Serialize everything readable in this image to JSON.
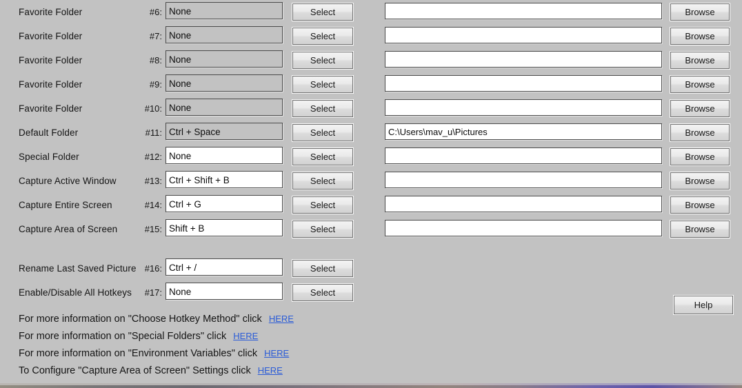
{
  "window": {
    "background_color": "#c2c2c2",
    "link_color": "#2a5bd7"
  },
  "buttons": {
    "select_label": "Select",
    "browse_label": "Browse",
    "help_label": "Help"
  },
  "rows": [
    {
      "label": "Favorite Folder",
      "number": "#6:",
      "hotkey": "None",
      "hotkey_disabled": true,
      "path": "",
      "has_path": true
    },
    {
      "label": "Favorite Folder",
      "number": "#7:",
      "hotkey": "None",
      "hotkey_disabled": true,
      "path": "",
      "has_path": true
    },
    {
      "label": "Favorite Folder",
      "number": "#8:",
      "hotkey": "None",
      "hotkey_disabled": true,
      "path": "",
      "has_path": true
    },
    {
      "label": "Favorite Folder",
      "number": "#9:",
      "hotkey": "None",
      "hotkey_disabled": true,
      "path": "",
      "has_path": true
    },
    {
      "label": "Favorite Folder",
      "number": "#10:",
      "hotkey": "None",
      "hotkey_disabled": true,
      "path": "",
      "has_path": true
    },
    {
      "label": "Default Folder",
      "number": "#11:",
      "hotkey": "Ctrl + Space",
      "hotkey_disabled": true,
      "path": "C:\\Users\\mav_u\\Pictures",
      "has_path": true
    },
    {
      "label": "Special Folder",
      "number": "#12:",
      "hotkey": "None",
      "hotkey_disabled": false,
      "path": "",
      "has_path": true
    },
    {
      "label": "Capture Active Window",
      "number": "#13:",
      "hotkey": "Ctrl + Shift + B",
      "hotkey_disabled": false,
      "path": "",
      "has_path": true
    },
    {
      "label": "Capture Entire Screen",
      "number": "#14:",
      "hotkey": "Ctrl + G",
      "hotkey_disabled": false,
      "path": "",
      "has_path": true
    },
    {
      "label": "Capture Area of Screen",
      "number": "#15:",
      "hotkey": "Shift + B",
      "hotkey_disabled": false,
      "path": "",
      "has_path": true
    },
    {
      "label": "Rename Last Saved Picture",
      "number": "#16:",
      "hotkey": "Ctrl + /",
      "hotkey_disabled": false,
      "path": "",
      "has_path": false
    },
    {
      "label": "Enable/Disable All Hotkeys",
      "number": "#17:",
      "hotkey": "None",
      "hotkey_disabled": false,
      "path": "",
      "has_path": false
    }
  ],
  "info_links": [
    {
      "text": "For more information on \"Choose Hotkey Method\" click",
      "link": "HERE"
    },
    {
      "text": "For more information on \"Special Folders\" click",
      "link": "HERE"
    },
    {
      "text": "For more information on \"Environment Variables\" click",
      "link": "HERE"
    },
    {
      "text": "To Configure \"Capture Area of Screen\" Settings click",
      "link": "HERE"
    }
  ]
}
